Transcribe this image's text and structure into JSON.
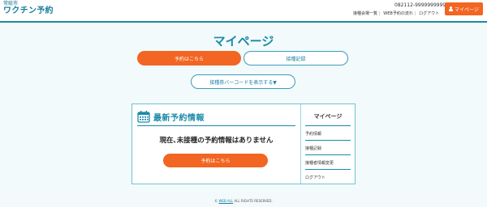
{
  "header": {
    "city": "常総市",
    "app_name": "ワクチン予約",
    "user_id": "082112-9999999999",
    "links": [
      "接種会場一覧",
      "WEB予約の流れ",
      "ログアウト"
    ],
    "mypage_button": "マイページ"
  },
  "page_title": "マイページ",
  "tabs": [
    {
      "label": "予約はこちら",
      "active": true
    },
    {
      "label": "接種記録",
      "active": false
    }
  ],
  "barcode_button": "接種券バーコードを表示する▼",
  "latest": {
    "title": "最新予約情報",
    "empty_message": "現在､未接種の予約情報はありません",
    "reserve_button": "予約はこちら"
  },
  "sidebar": {
    "title": "マイページ",
    "items": [
      "予約情報",
      "接種記録",
      "接種者情報変更",
      "ログアウト"
    ]
  },
  "footer": {
    "prefix": "©",
    "link_text": "WEB ALL",
    "suffix": "ALL RIGHTS RESERVED."
  },
  "colors": {
    "accent": "#f26522",
    "primary": "#1a8aa8",
    "background": "#f2fafb"
  }
}
